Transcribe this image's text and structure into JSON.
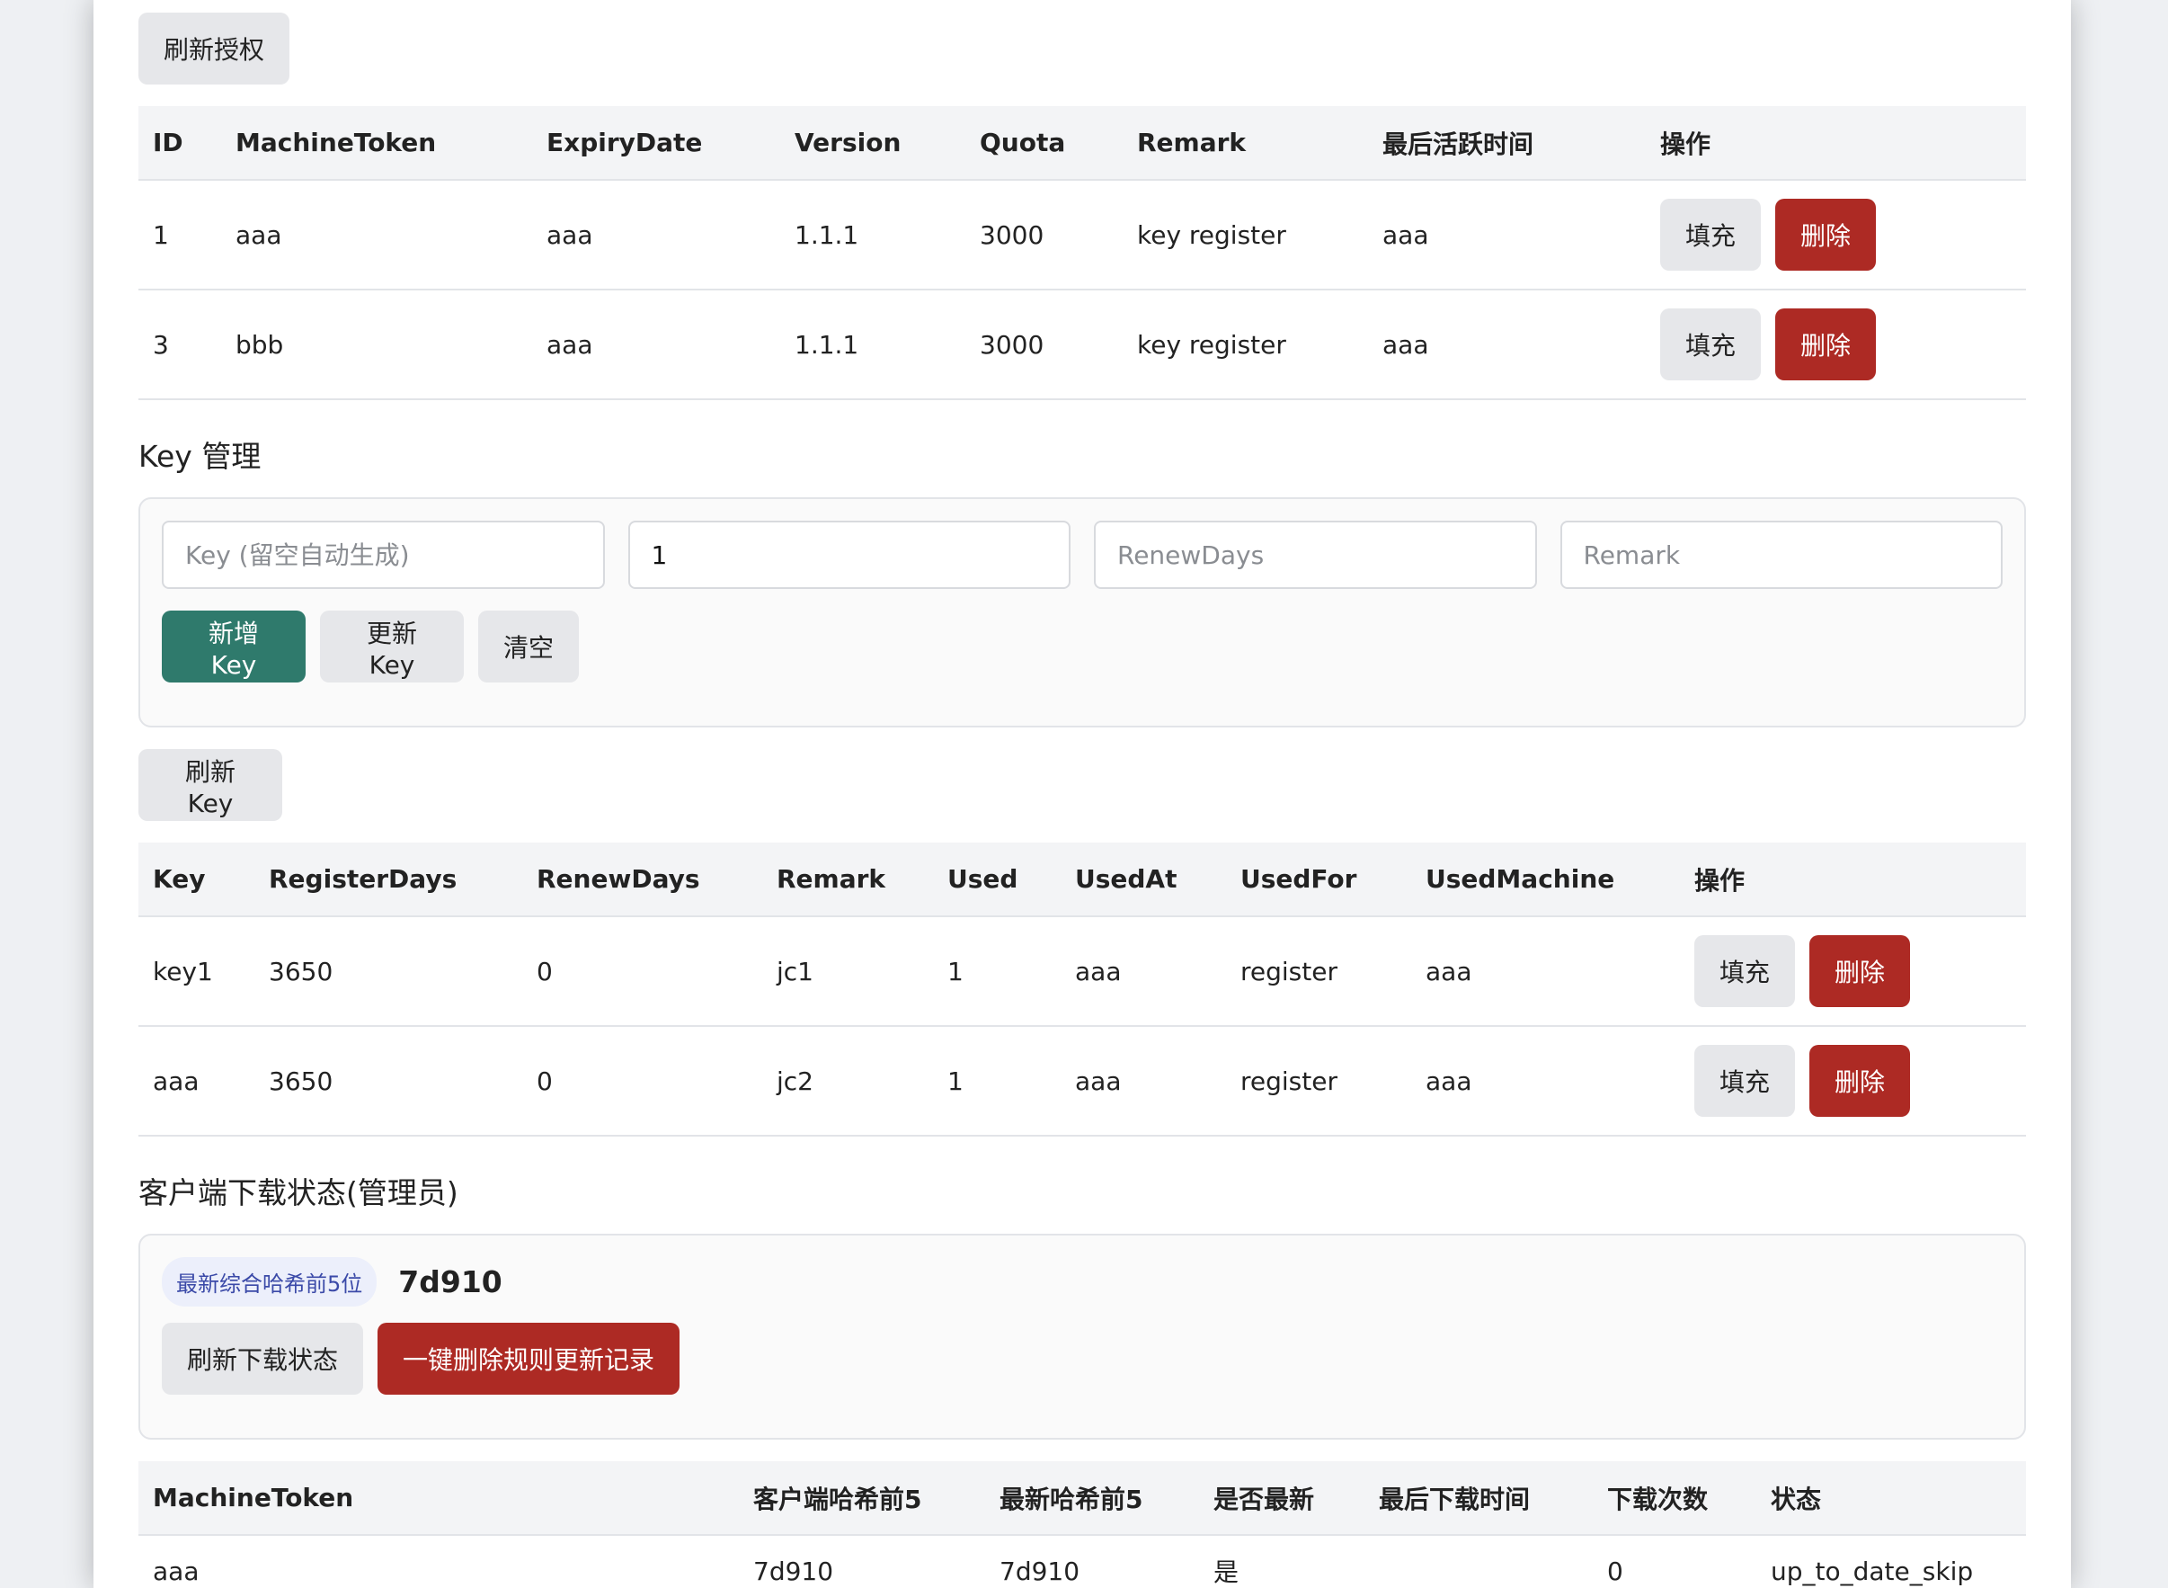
{
  "auth": {
    "refresh_label": "刷新授权",
    "columns": [
      "ID",
      "MachineToken",
      "ExpiryDate",
      "Version",
      "Quota",
      "Remark",
      "最后活跃时间",
      "操作"
    ],
    "rows": [
      {
        "id": "1",
        "token": "aaa",
        "expiry": "aaa",
        "version": "1.1.1",
        "quota": "3000",
        "remark": "key register",
        "last_active": "aaa"
      },
      {
        "id": "3",
        "token": "bbb",
        "expiry": "aaa",
        "version": "1.1.1",
        "quota": "3000",
        "remark": "key register",
        "last_active": "aaa"
      }
    ],
    "fill_label": "填充",
    "delete_label": "删除"
  },
  "key_mgmt": {
    "title": "Key 管理",
    "key_placeholder": "Key (留空自动生成)",
    "register_days_value": "1",
    "renew_placeholder": "RenewDays",
    "remark_placeholder": "Remark",
    "add_label": "新增Key",
    "update_label": "更新Key",
    "clear_label": "清空"
  },
  "keys": {
    "refresh_label": "刷新Key",
    "columns": [
      "Key",
      "RegisterDays",
      "RenewDays",
      "Remark",
      "Used",
      "UsedAt",
      "UsedFor",
      "UsedMachine",
      "操作"
    ],
    "rows": [
      {
        "key": "key1",
        "register_days": "3650",
        "renew_days": "0",
        "remark": "jc1",
        "used": "1",
        "used_at": "aaa",
        "used_for": "register",
        "used_machine": "aaa"
      },
      {
        "key": "aaa",
        "register_days": "3650",
        "renew_days": "0",
        "remark": "jc2",
        "used": "1",
        "used_at": "aaa",
        "used_for": "register",
        "used_machine": "aaa"
      }
    ],
    "fill_label": "填充",
    "delete_label": "删除"
  },
  "download": {
    "title": "客户端下载状态(管理员)",
    "badge": "最新综合哈希前5位",
    "hash": "7d910",
    "refresh_label": "刷新下载状态",
    "delete_label": "一键删除规则更新记录",
    "columns": [
      "MachineToken",
      "客户端哈希前5",
      "最新哈希前5",
      "是否最新",
      "最后下载时间",
      "下载次数",
      "状态"
    ],
    "rows": [
      {
        "token": "aaa",
        "client_hash": "7d910",
        "latest_hash": "7d910",
        "is_latest": "是",
        "last_download": "",
        "count": "0",
        "status": "up_to_date_skip"
      }
    ]
  },
  "colors": {
    "danger": "#ad2a24",
    "primary": "#2f7a6c",
    "secondary": "#e6e7ea"
  }
}
